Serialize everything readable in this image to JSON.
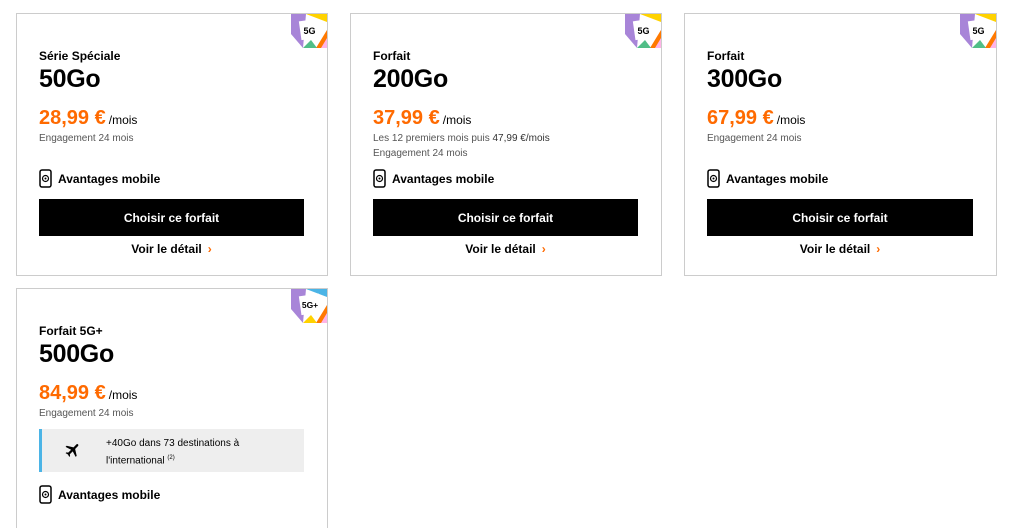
{
  "colors": {
    "accent": "#ff6a00",
    "button_bg": "#000000",
    "perk_border": "#4bb4e6"
  },
  "cards": [
    {
      "badge": "5G",
      "kicker": "Série Spéciale",
      "title": "50Go",
      "price": "28,99 €",
      "per": "/mois",
      "engagement": "Engagement 24 mois",
      "avantages": "Avantages mobile",
      "cta": "Choisir ce forfait",
      "detail": "Voir le détail"
    },
    {
      "badge": "5G",
      "kicker": "Forfait",
      "title": "200Go",
      "price": "37,99 €",
      "per": "/mois",
      "promo_prefix": "Les 12 premiers mois puis ",
      "promo_price": "47,99 €/mois",
      "engagement": "Engagement 24 mois",
      "avantages": "Avantages mobile",
      "cta": "Choisir ce forfait",
      "detail": "Voir le détail"
    },
    {
      "badge": "5G",
      "kicker": "Forfait",
      "title": "300Go",
      "price": "67,99 €",
      "per": "/mois",
      "engagement": "Engagement 24 mois",
      "avantages": "Avantages mobile",
      "cta": "Choisir ce forfait",
      "detail": "Voir le détail"
    },
    {
      "badge": "5G+",
      "kicker": "Forfait 5G+",
      "title": "500Go",
      "price": "84,99 €",
      "per": "/mois",
      "engagement": "Engagement 24 mois",
      "perk_line1": "+40Go dans 73 destinations à",
      "perk_line2": "l'international",
      "perk_note": "(2)",
      "avantages": "Avantages mobile"
    }
  ],
  "icons": {
    "badge": "5g-badge-icon",
    "phone": "phone-icon",
    "plane": "airplane-icon",
    "chevron": "chevron-right-icon"
  }
}
